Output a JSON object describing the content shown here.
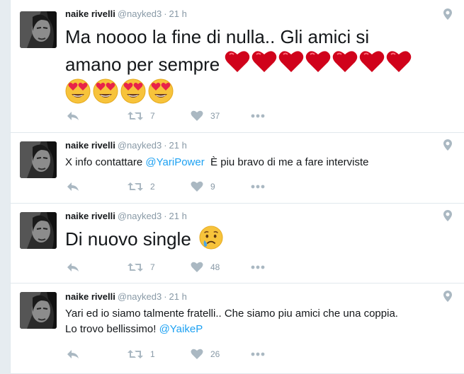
{
  "colors": {
    "mention": "#1da1f2",
    "muted": "#8899a6",
    "icon": "#aab8c2",
    "heart_emoji": "#d0021b"
  },
  "tweets": [
    {
      "name": "naike rivelli",
      "handle": "@nayked3",
      "time": "21 h",
      "text_line1": "Ma noooo la fine di nulla.. Gli amici si",
      "text_line2": "amano per sempre",
      "emoji_hearts": 7,
      "emoji_heart_eyes": 4,
      "retweets": "7",
      "likes": "37"
    },
    {
      "name": "naike rivelli",
      "handle": "@nayked3",
      "time": "21 h",
      "text_before": "X info contattare ",
      "mention": "@YariPower",
      "text_after": "  È piu bravo di me a fare interviste",
      "retweets": "2",
      "likes": "9"
    },
    {
      "name": "naike rivelli",
      "handle": "@nayked3",
      "time": "21 h",
      "text": "Di nuovo single",
      "emoji": "crying-face",
      "retweets": "7",
      "likes": "48"
    },
    {
      "name": "naike rivelli",
      "handle": "@nayked3",
      "time": "21 h",
      "text_line1": "Yari ed io siamo talmente fratelli.. Che siamo piu amici che una coppia.",
      "text_line2_before": "Lo trovo bellissimo! ",
      "mention": "@YaikeP",
      "retweets": "1",
      "likes": "26"
    }
  ]
}
